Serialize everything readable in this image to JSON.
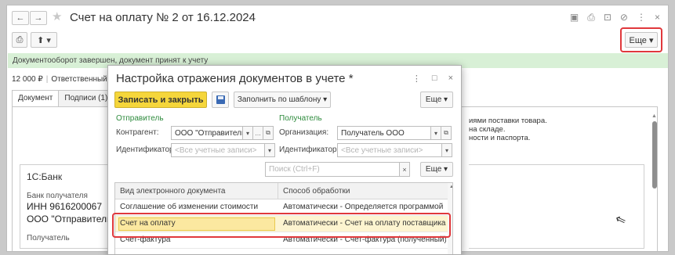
{
  "window": {
    "title": "Счет на оплату № 2 от 16.12.2024",
    "back_icon": "arrow-left",
    "forward_icon": "arrow-right",
    "icons": [
      "save-icon",
      "print-icon",
      "preview-icon",
      "link-icon",
      "menu-dots-icon",
      "close-icon"
    ]
  },
  "toolbar": {
    "print_icon": "⎙",
    "upload_label": "⬆ ▾",
    "more_label": "Еще ▾"
  },
  "status": {
    "text": "Документооборот завершен, документ принят к учету"
  },
  "doc": {
    "amount": "12 000 ₽",
    "responsible_label": "Ответственный:",
    "tabs": [
      "Документ",
      "Подписи (1)"
    ],
    "bank_name": "1С:Банк",
    "bank_label": "Банк получателя",
    "inn": "ИНН  9616200067",
    "sender": "ООО \"Отправитель\"",
    "recipient_label": "Получатель",
    "right_text": [
      "иями поставки товара.",
      "на складе.",
      "ности и паспорта."
    ]
  },
  "dialog": {
    "title": "Настройка отражения документов в учете *",
    "save_close_label": "Записать и закрыть",
    "template_label": "Заполнить по шаблону ▾",
    "more_label": "Еще ▾",
    "sender_section": "Отправитель",
    "receiver_section": "Получатель",
    "counterparty_label": "Контрагент:",
    "counterparty_value": "ООО \"Отправитель\"",
    "organization_label": "Организация:",
    "organization_value": "Получатель ООО",
    "identifier_label": "Идентификатор:",
    "identifier_placeholder": "<Все учетные записи>",
    "search_placeholder": "Поиск (Ctrl+F)",
    "table": {
      "headers": [
        "Вид электронного документа",
        "Способ обработки"
      ],
      "rows": [
        [
          "Соглашение об изменении стоимости",
          "Автоматически - Определяется программой"
        ],
        [
          "Счет на оплату",
          "Автоматически - Счет на оплату поставщика"
        ],
        [
          "Счет-фактура",
          "Автоматически - Счет-фактура (полученный)"
        ]
      ]
    }
  },
  "colors": {
    "accent_yellow": "#f5d63b",
    "status_green": "#d8f0d6",
    "highlight_red": "#e0383c",
    "section_green": "#2e8b3d"
  }
}
